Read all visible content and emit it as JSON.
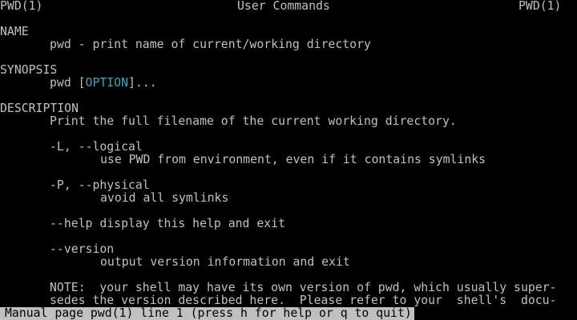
{
  "header": {
    "left": "PWD(1)",
    "center": "User Commands",
    "right": "PWD(1)"
  },
  "sections": {
    "name_heading": "NAME",
    "name_text": "pwd - print name of current/working directory",
    "synopsis_heading": "SYNOPSIS",
    "synopsis_cmd": "pwd [",
    "synopsis_option": "OPTION",
    "synopsis_tail": "]...",
    "description_heading": "DESCRIPTION",
    "description_text": "Print the full filename of the current working directory.",
    "options": [
      {
        "flag": "-L, --logical",
        "desc": "use PWD from environment, even if it contains symlinks"
      },
      {
        "flag": "-P, --physical",
        "desc": "avoid all symlinks"
      }
    ],
    "help_line": "--help display this help and exit",
    "version_flag": "--version",
    "version_desc": "output version information and exit",
    "note_line1": "NOTE:  your shell may have its own version of pwd, which usually super-",
    "note_line2": "sedes the version described here.  Please refer to your  shell's  docu-"
  },
  "status": {
    "text": "Manual page pwd(1) line 1 (press h for help or q to quit)"
  },
  "colors": {
    "background": "#000000",
    "foreground": "#c0c0c0",
    "option_highlight": "#3aa8b8"
  }
}
